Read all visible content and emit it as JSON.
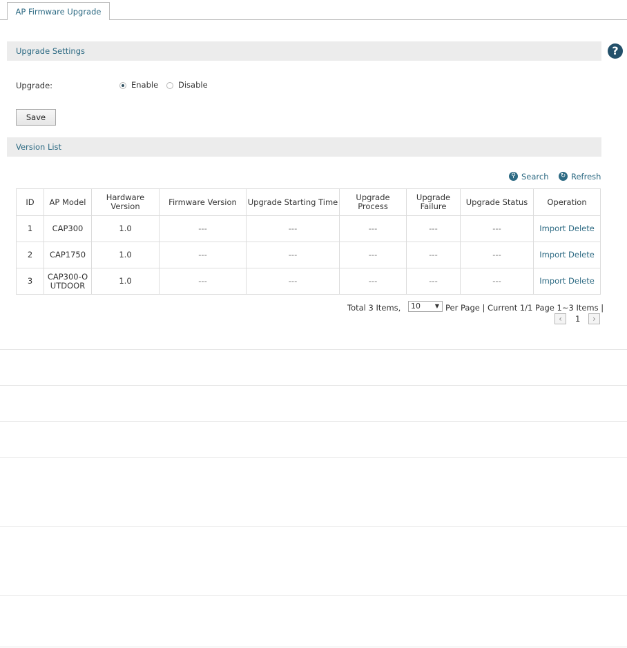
{
  "tabs": [
    {
      "label": "AP Firmware Upgrade"
    }
  ],
  "upgrade_settings": {
    "title": "Upgrade Settings",
    "upgrade_label": "Upgrade:",
    "options": [
      "Enable",
      "Disable"
    ],
    "selected": "Enable",
    "save_label": "Save"
  },
  "help_icon": "?",
  "version_list": {
    "title": "Version List",
    "search_label": "Search",
    "refresh_label": "Refresh",
    "columns": [
      "ID",
      "AP Model",
      "Hardware Version",
      "Firmware Version",
      "Upgrade Starting Time",
      "Upgrade Process",
      "Upgrade Failure",
      "Upgrade Status",
      "Operation"
    ],
    "rows": [
      {
        "id": "1",
        "model": "CAP300",
        "hw": "1.0",
        "fw": "---",
        "start": "---",
        "process": "---",
        "failure": "---",
        "status": "---",
        "import": "Import",
        "delete": "Delete"
      },
      {
        "id": "2",
        "model": "CAP1750",
        "hw": "1.0",
        "fw": "---",
        "start": "---",
        "process": "---",
        "failure": "---",
        "status": "---",
        "import": "Import",
        "delete": "Delete"
      },
      {
        "id": "3",
        "model": "CAP300-OUTDOOR",
        "hw": "1.0",
        "fw": "---",
        "start": "---",
        "process": "---",
        "failure": "---",
        "status": "---",
        "import": "Import",
        "delete": "Delete"
      }
    ],
    "pager": {
      "total_text": "Total 3 Items,",
      "per_page_value": "10",
      "info_text": "Per Page | Current 1/1 Page 1~3 Items |",
      "current_page": "1"
    }
  },
  "colors": {
    "accent": "#2d6a83",
    "section_bg": "#ececec",
    "help_bg": "#23506a"
  },
  "icons": {
    "search": "search-icon",
    "refresh": "refresh-icon",
    "help": "help-icon",
    "prev": "chevron-left-icon",
    "next": "chevron-right-icon"
  }
}
